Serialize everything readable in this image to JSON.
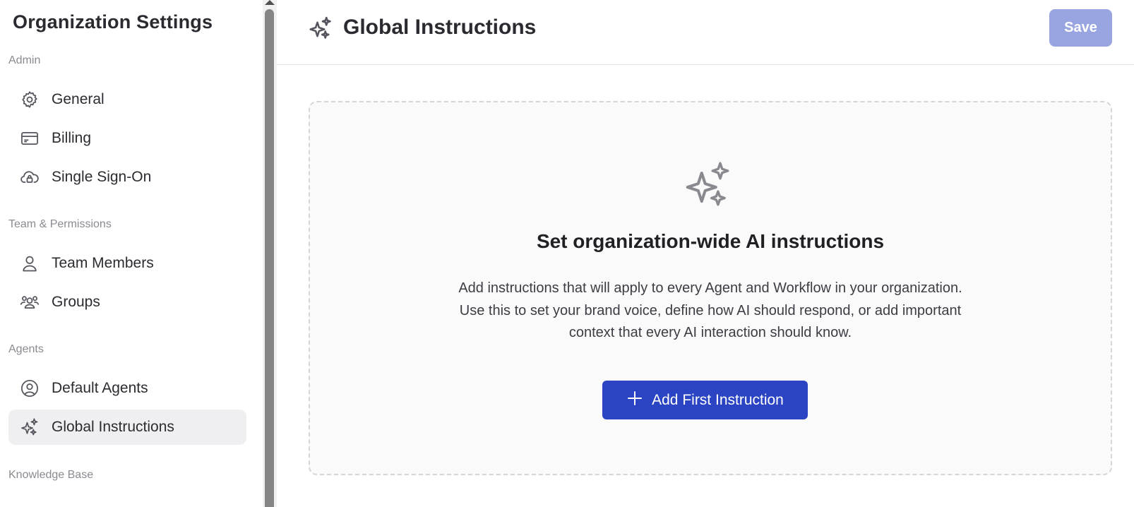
{
  "sidebar": {
    "title": "Organization Settings",
    "sections": [
      {
        "label": "Admin"
      },
      {
        "label": "Team & Permissions"
      },
      {
        "label": "Agents"
      },
      {
        "label": "Knowledge Base"
      }
    ],
    "items": [
      {
        "label": "General",
        "icon": "gear-icon"
      },
      {
        "label": "Billing",
        "icon": "credit-card-icon"
      },
      {
        "label": "Single Sign-On",
        "icon": "cloud-lock-icon"
      },
      {
        "label": "Team Members",
        "icon": "user-icon"
      },
      {
        "label": "Groups",
        "icon": "users-group-icon"
      },
      {
        "label": "Default Agents",
        "icon": "user-circle-icon"
      },
      {
        "label": "Global Instructions",
        "icon": "sparkles-icon",
        "active": true
      }
    ]
  },
  "header": {
    "title": "Global Instructions",
    "icon": "sparkles-icon",
    "save_label": "Save"
  },
  "empty_state": {
    "icon": "sparkles-icon",
    "title": "Set organization-wide AI instructions",
    "description": "Add instructions that will apply to every Agent and Workflow in your organization. Use this to set your brand voice, define how AI should respond, or add important context that every AI interaction should know.",
    "button_label": "Add First Instruction",
    "button_icon": "plus-icon"
  },
  "colors": {
    "primary": "#2b44c3",
    "save_disabled": "#98a5e0",
    "active_item_bg": "#efeff1"
  }
}
